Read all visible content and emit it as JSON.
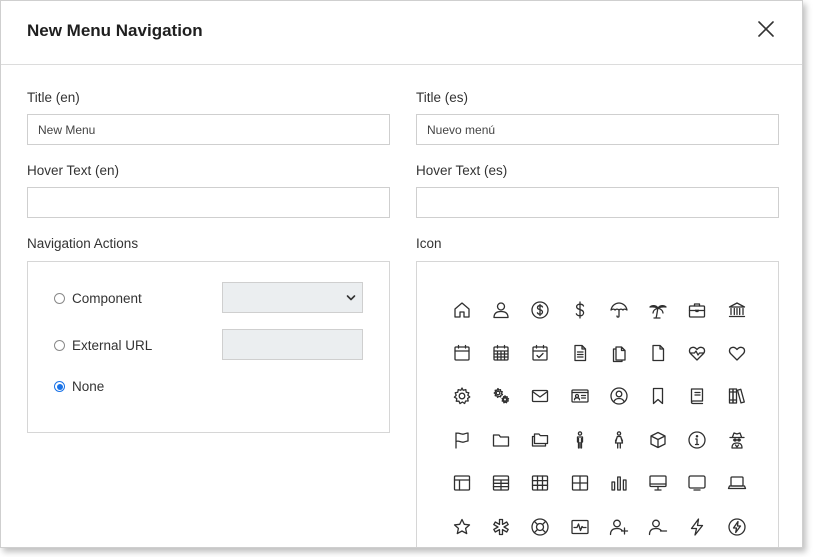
{
  "modal": {
    "title": "New Menu Navigation"
  },
  "fields": {
    "title_en": {
      "label": "Title (en)",
      "value": "New Menu"
    },
    "title_es": {
      "label": "Title (es)",
      "value": "Nuevo menú"
    },
    "hover_en": {
      "label": "Hover Text (en)",
      "value": ""
    },
    "hover_es": {
      "label": "Hover Text (es)",
      "value": ""
    }
  },
  "navigation": {
    "label": "Navigation Actions",
    "options": [
      {
        "label": "Component",
        "checked": false
      },
      {
        "label": "External URL",
        "checked": false
      },
      {
        "label": "None",
        "checked": true
      }
    ],
    "component_select_value": "",
    "external_url_value": ""
  },
  "icon_picker": {
    "label": "Icon",
    "icons": [
      "home-icon",
      "user-icon",
      "dollar-circle-icon",
      "dollar-icon",
      "umbrella-icon",
      "palm-tree-icon",
      "briefcase-icon",
      "bank-icon",
      "calendar-icon",
      "calendar-grid-icon",
      "calendar-check-icon",
      "document-text-icon",
      "documents-icon",
      "document-icon",
      "heart-pulse-icon",
      "heart-icon",
      "gear-icon",
      "gears-icon",
      "envelope-icon",
      "id-card-icon",
      "user-circle-icon",
      "bookmark-icon",
      "book-icon",
      "library-icon",
      "flag-icon",
      "folder-icon",
      "folders-icon",
      "man-icon",
      "woman-icon",
      "cube-icon",
      "info-icon",
      "spy-icon",
      "layout-icon",
      "table-icon",
      "grid-icon",
      "window-grid-icon",
      "bar-chart-icon",
      "desktop-icon",
      "monitor-icon",
      "laptop-icon",
      "star-icon",
      "asterisk-icon",
      "lifebuoy-icon",
      "pulse-monitor-icon",
      "user-plus-icon",
      "user-minus-icon",
      "lightning-icon",
      "lightning-circle-icon"
    ]
  },
  "colors": {
    "accent": "#1a73e8",
    "border": "#cfcfcf",
    "disabled_bg": "#ebeef0"
  }
}
